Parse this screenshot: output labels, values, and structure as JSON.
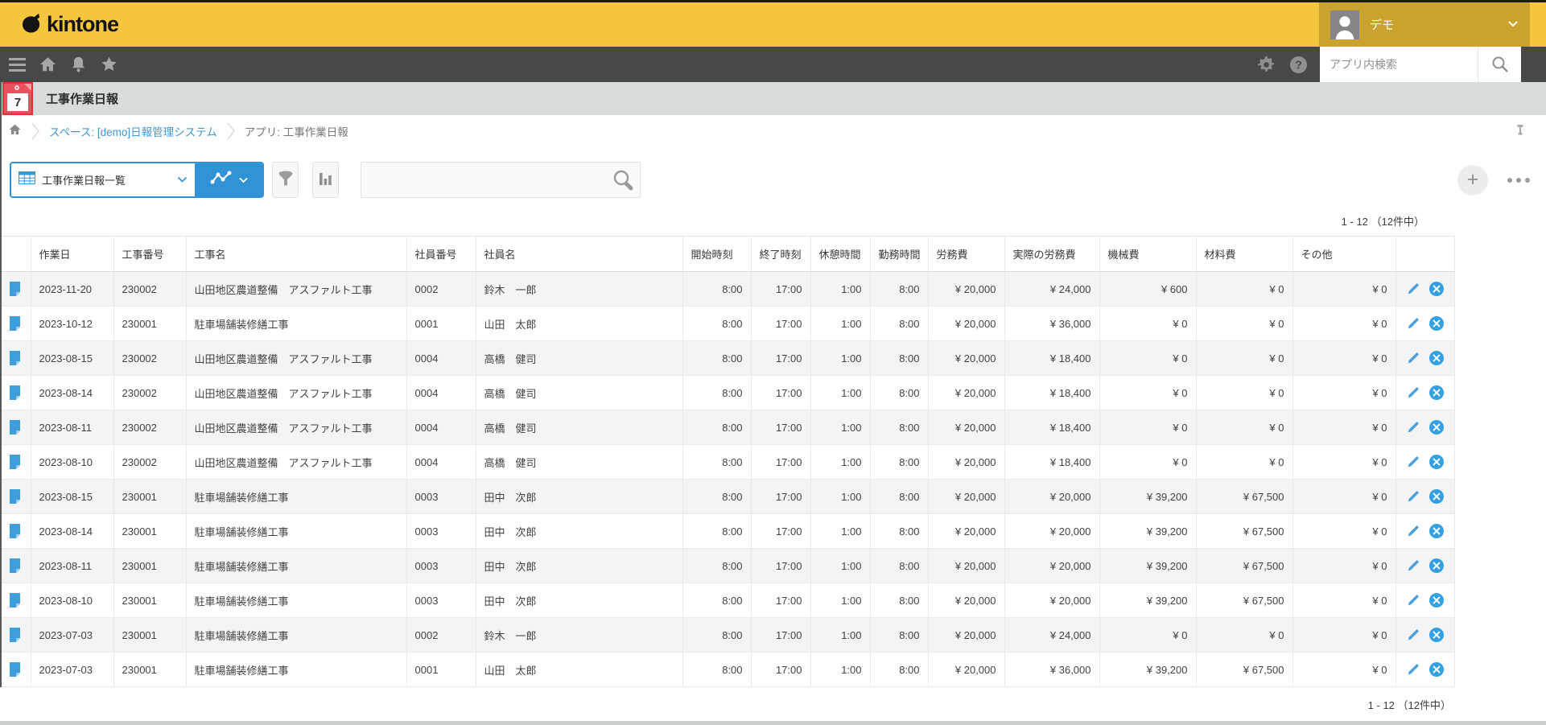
{
  "colors": {
    "brand_yellow": "#f5c63e",
    "user_block_yellow": "#c9a32d",
    "nav_dark": "#484848",
    "accent_blue": "#3193d5",
    "link_blue": "#3b98d9",
    "app_icon_red": "#e8525e",
    "row_stripe": "#f4f4f4"
  },
  "header": {
    "logo": "kintone",
    "user_name": "デモ"
  },
  "global_nav": {
    "search_placeholder": "アプリ内検索"
  },
  "app_bar": {
    "icon_day": "7",
    "title": "工事作業日報"
  },
  "breadcrumb": {
    "space_link": "スペース: [demo]日報管理システム",
    "app_label": "アプリ: 工事作業日報"
  },
  "view_toolbar": {
    "view_name": "工事作業日報一覧",
    "search_value": ""
  },
  "pagination": {
    "top": "1 - 12 （12件中）",
    "bottom": "1 - 12 （12件中）"
  },
  "table": {
    "columns": [
      {
        "key": "workDate",
        "label": "作業日",
        "align": "left"
      },
      {
        "key": "projectNo",
        "label": "工事番号",
        "align": "left"
      },
      {
        "key": "projectName",
        "label": "工事名",
        "align": "left"
      },
      {
        "key": "employeeNo",
        "label": "社員番号",
        "align": "left"
      },
      {
        "key": "employeeName",
        "label": "社員名",
        "align": "left"
      },
      {
        "key": "startTime",
        "label": "開始時刻",
        "align": "right"
      },
      {
        "key": "endTime",
        "label": "終了時刻",
        "align": "right"
      },
      {
        "key": "breakTime",
        "label": "休憩時間",
        "align": "right"
      },
      {
        "key": "workTime",
        "label": "勤務時間",
        "align": "right"
      },
      {
        "key": "laborCost",
        "label": "労務費",
        "align": "right"
      },
      {
        "key": "actualLaborCost",
        "label": "実際の労務費",
        "align": "right"
      },
      {
        "key": "machineCost",
        "label": "機械費",
        "align": "right"
      },
      {
        "key": "materialCost",
        "label": "材料費",
        "align": "right"
      },
      {
        "key": "otherCost",
        "label": "その他",
        "align": "right"
      }
    ],
    "rows": [
      [
        "2023-11-20",
        "230002",
        "山田地区農道整備　アスファルト工事",
        "0002",
        "鈴木　一郎",
        "8:00",
        "17:00",
        "1:00",
        "8:00",
        "¥ 20,000",
        "¥ 24,000",
        "¥ 600",
        "¥ 0",
        "¥ 0"
      ],
      [
        "2023-10-12",
        "230001",
        "駐車場舗装修繕工事",
        "0001",
        "山田　太郎",
        "8:00",
        "17:00",
        "1:00",
        "8:00",
        "¥ 20,000",
        "¥ 36,000",
        "¥ 0",
        "¥ 0",
        "¥ 0"
      ],
      [
        "2023-08-15",
        "230002",
        "山田地区農道整備　アスファルト工事",
        "0004",
        "高橋　健司",
        "8:00",
        "17:00",
        "1:00",
        "8:00",
        "¥ 20,000",
        "¥ 18,400",
        "¥ 0",
        "¥ 0",
        "¥ 0"
      ],
      [
        "2023-08-14",
        "230002",
        "山田地区農道整備　アスファルト工事",
        "0004",
        "高橋　健司",
        "8:00",
        "17:00",
        "1:00",
        "8:00",
        "¥ 20,000",
        "¥ 18,400",
        "¥ 0",
        "¥ 0",
        "¥ 0"
      ],
      [
        "2023-08-11",
        "230002",
        "山田地区農道整備　アスファルト工事",
        "0004",
        "高橋　健司",
        "8:00",
        "17:00",
        "1:00",
        "8:00",
        "¥ 20,000",
        "¥ 18,400",
        "¥ 0",
        "¥ 0",
        "¥ 0"
      ],
      [
        "2023-08-10",
        "230002",
        "山田地区農道整備　アスファルト工事",
        "0004",
        "高橋　健司",
        "8:00",
        "17:00",
        "1:00",
        "8:00",
        "¥ 20,000",
        "¥ 18,400",
        "¥ 0",
        "¥ 0",
        "¥ 0"
      ],
      [
        "2023-08-15",
        "230001",
        "駐車場舗装修繕工事",
        "0003",
        "田中　次郎",
        "8:00",
        "17:00",
        "1:00",
        "8:00",
        "¥ 20,000",
        "¥ 20,000",
        "¥ 39,200",
        "¥ 67,500",
        "¥ 0"
      ],
      [
        "2023-08-14",
        "230001",
        "駐車場舗装修繕工事",
        "0003",
        "田中　次郎",
        "8:00",
        "17:00",
        "1:00",
        "8:00",
        "¥ 20,000",
        "¥ 20,000",
        "¥ 39,200",
        "¥ 67,500",
        "¥ 0"
      ],
      [
        "2023-08-11",
        "230001",
        "駐車場舗装修繕工事",
        "0003",
        "田中　次郎",
        "8:00",
        "17:00",
        "1:00",
        "8:00",
        "¥ 20,000",
        "¥ 20,000",
        "¥ 39,200",
        "¥ 67,500",
        "¥ 0"
      ],
      [
        "2023-08-10",
        "230001",
        "駐車場舗装修繕工事",
        "0003",
        "田中　次郎",
        "8:00",
        "17:00",
        "1:00",
        "8:00",
        "¥ 20,000",
        "¥ 20,000",
        "¥ 39,200",
        "¥ 67,500",
        "¥ 0"
      ],
      [
        "2023-07-03",
        "230001",
        "駐車場舗装修繕工事",
        "0002",
        "鈴木　一郎",
        "8:00",
        "17:00",
        "1:00",
        "8:00",
        "¥ 20,000",
        "¥ 24,000",
        "¥ 0",
        "¥ 0",
        "¥ 0"
      ],
      [
        "2023-07-03",
        "230001",
        "駐車場舗装修繕工事",
        "0001",
        "山田　太郎",
        "8:00",
        "17:00",
        "1:00",
        "8:00",
        "¥ 20,000",
        "¥ 36,000",
        "¥ 39,200",
        "¥ 67,500",
        "¥ 0"
      ]
    ]
  }
}
